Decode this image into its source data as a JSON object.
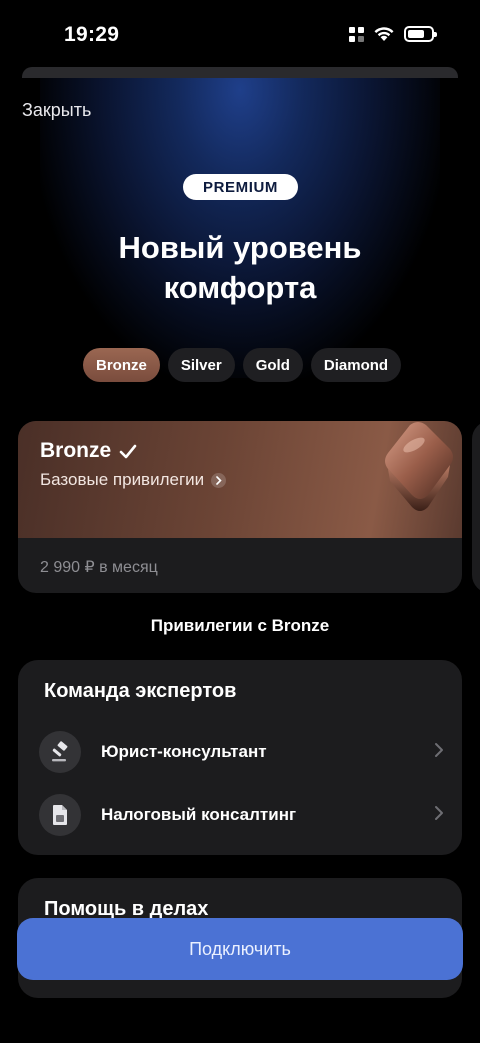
{
  "status": {
    "time": "19:29"
  },
  "header": {
    "close_label": "Закрыть"
  },
  "hero": {
    "badge": "PREMIUM",
    "title_line1": "Новый уровень",
    "title_line2": "комфорта"
  },
  "tiers": [
    {
      "label": "Bronze",
      "active": true
    },
    {
      "label": "Silver",
      "active": false
    },
    {
      "label": "Gold",
      "active": false
    },
    {
      "label": "Diamond",
      "active": false
    }
  ],
  "selected_tier": {
    "name": "Bronze",
    "subtitle": "Базовые привилегии",
    "price": "2 990 ₽ в месяц"
  },
  "privileges": {
    "caption": "Привилегии с Bronze",
    "groups": [
      {
        "title": "Команда экспертов",
        "items": [
          {
            "label": "Юрист-консультант",
            "icon": "gavel-icon"
          },
          {
            "label": "Налоговый консалтинг",
            "icon": "tax-document-icon"
          }
        ]
      },
      {
        "title": "Помощь в делах",
        "items": []
      }
    ]
  },
  "cta": {
    "label": "Подключить"
  },
  "colors": {
    "accent": "#4b72d4",
    "bronze": "#8a5a46",
    "card": "#1c1c1e"
  }
}
